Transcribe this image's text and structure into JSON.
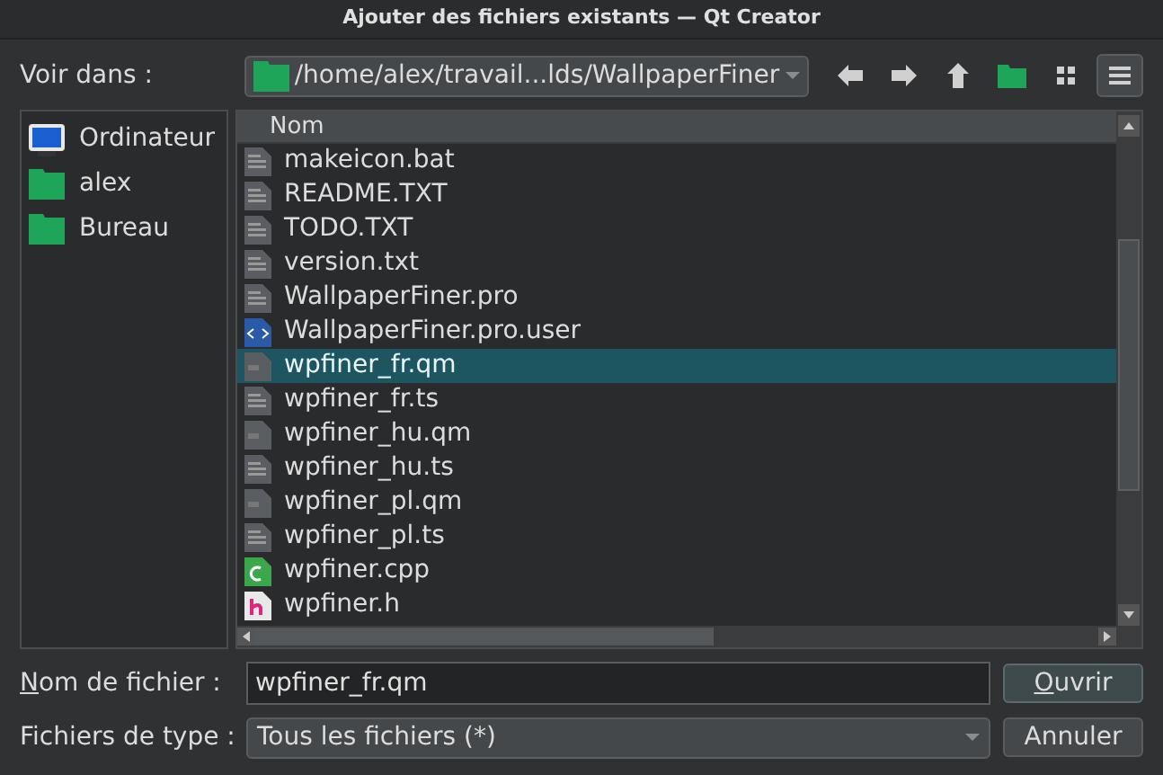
{
  "window": {
    "title": "Ajouter des fichiers existants — Qt Creator"
  },
  "look_in": {
    "label": "Voir dans :",
    "path": "/home/alex/travail...lds/WallpaperFiner"
  },
  "toolbar": [
    {
      "kind": "back"
    },
    {
      "kind": "forward"
    },
    {
      "kind": "up"
    },
    {
      "kind": "new-folder"
    },
    {
      "kind": "icon-view",
      "selected": false
    },
    {
      "kind": "list-view",
      "selected": true
    }
  ],
  "sidebar": {
    "items": [
      {
        "label": "Ordinateur",
        "kind": "computer"
      },
      {
        "label": "alex",
        "kind": "folder"
      },
      {
        "label": "Bureau",
        "kind": "folder"
      }
    ]
  },
  "file_list": {
    "column": "Nom",
    "rows": [
      {
        "name": "makeicon.bat",
        "kind": "text",
        "selected": false
      },
      {
        "name": "README.TXT",
        "kind": "text",
        "selected": false
      },
      {
        "name": "TODO.TXT",
        "kind": "text",
        "selected": false
      },
      {
        "name": "version.txt",
        "kind": "text",
        "selected": false
      },
      {
        "name": "WallpaperFiner.pro",
        "kind": "text",
        "selected": false
      },
      {
        "name": "WallpaperFiner.pro.user",
        "kind": "xml",
        "selected": false
      },
      {
        "name": "wpfiner_fr.qm",
        "kind": "binary",
        "selected": true
      },
      {
        "name": "wpfiner_fr.ts",
        "kind": "text",
        "selected": false
      },
      {
        "name": "wpfiner_hu.qm",
        "kind": "binary",
        "selected": false
      },
      {
        "name": "wpfiner_hu.ts",
        "kind": "text",
        "selected": false
      },
      {
        "name": "wpfiner_pl.qm",
        "kind": "binary",
        "selected": false
      },
      {
        "name": "wpfiner_pl.ts",
        "kind": "text",
        "selected": false
      },
      {
        "name": "wpfiner.cpp",
        "kind": "cpp",
        "selected": false
      },
      {
        "name": "wpfiner.h",
        "kind": "header",
        "selected": false
      }
    ]
  },
  "file_name": {
    "label": "Nom de fichier :",
    "value": "wpfiner_fr.qm"
  },
  "file_type": {
    "label": "Fichiers de type :",
    "value": "Tous les fichiers (*)"
  },
  "buttons": [
    {
      "label": "Ouvrir",
      "underline_first": true
    },
    {
      "label": "Annuler",
      "underline_first": false
    }
  ]
}
